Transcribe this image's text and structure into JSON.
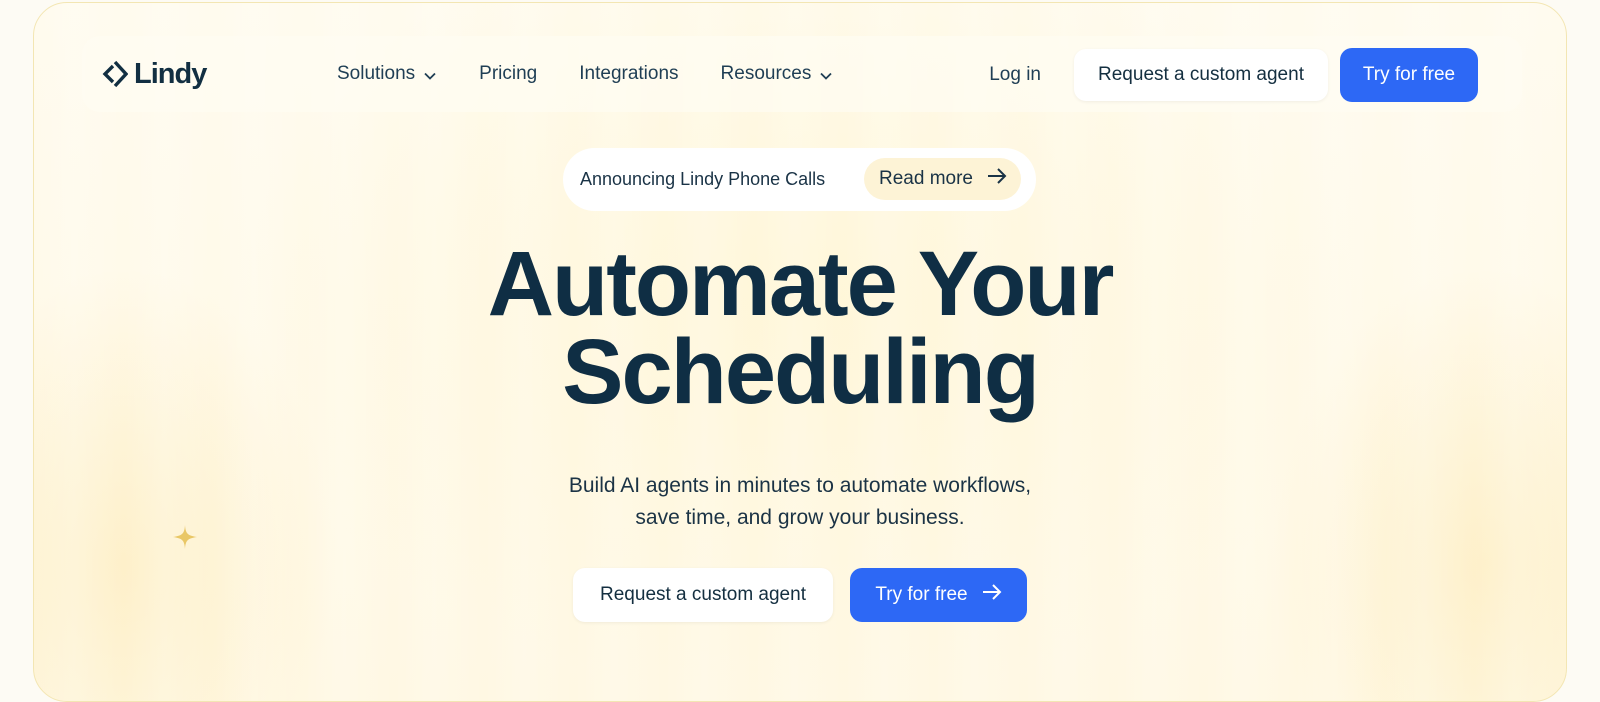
{
  "brand": {
    "name": "Lindy",
    "accent": "#2d68f5",
    "text_color": "#0f2e44"
  },
  "nav": {
    "items": [
      {
        "label": "Solutions",
        "has_dropdown": true
      },
      {
        "label": "Pricing",
        "has_dropdown": false
      },
      {
        "label": "Integrations",
        "has_dropdown": false
      },
      {
        "label": "Resources",
        "has_dropdown": true
      }
    ],
    "login_label": "Log in",
    "custom_agent_label": "Request a custom agent",
    "try_free_label": "Try for free"
  },
  "announcement": {
    "text": "Announcing Lindy Phone Calls",
    "link_label": "Read more",
    "icon": "arrow-right-icon"
  },
  "hero": {
    "title_line1": "Automate Your",
    "title_line2": "Scheduling",
    "subtitle_line1": "Build AI agents in minutes to automate workflows,",
    "subtitle_line2": "save time, and grow your business.",
    "cta_secondary": "Request a custom agent",
    "cta_primary": "Try for free",
    "cta_primary_icon": "arrow-right-icon"
  },
  "decorations": {
    "sparkle_icon": "sparkle-icon"
  }
}
